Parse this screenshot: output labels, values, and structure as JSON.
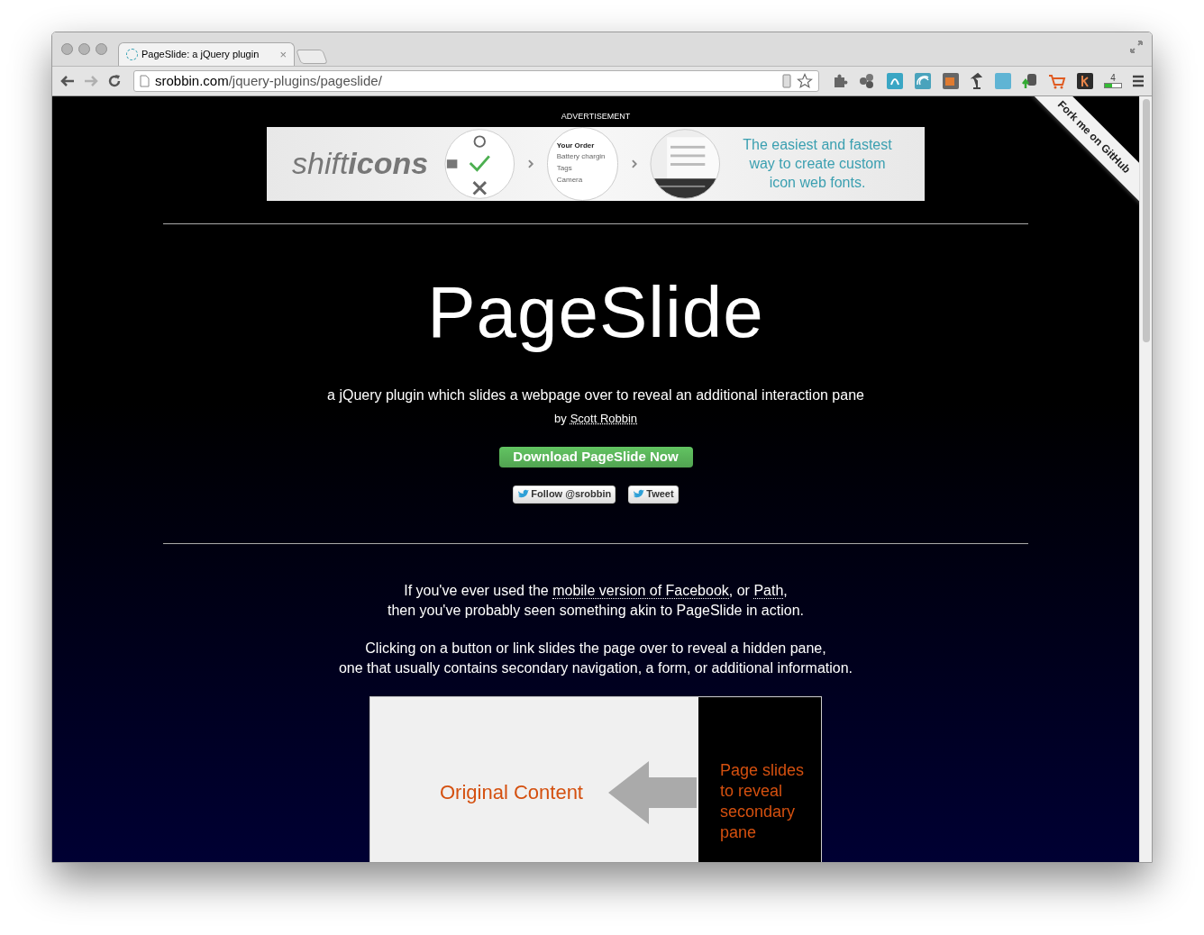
{
  "browser": {
    "tab": {
      "title": "PageSlide: a jQuery plugin",
      "close": "×"
    },
    "address": {
      "domain": "srobbin.com",
      "path": "/jquery-plugins/pageslide/"
    },
    "forward_disabled": true,
    "extension_badge": "4"
  },
  "ad": {
    "label": "ADVERTISEMENT",
    "logo_light": "shift",
    "logo_bold": "icons",
    "order_title": "Your Order",
    "order_items": [
      "Battery chargin",
      "Tags",
      "Camera"
    ],
    "tagline": "The easiest and fastest way to create custom icon web fonts."
  },
  "ribbon": "Fork me on GitHub",
  "hero": {
    "title": "PageSlide",
    "subtitle": "a jQuery plugin which slides a webpage over to reveal an additional interaction pane",
    "byline_prefix": "by",
    "author_link": "Scott Robbin",
    "download_button": "Download PageSlide Now",
    "follow_button": "Follow @srobbin",
    "tweet_button": "Tweet"
  },
  "intro": [
    [
      [
        {
          "text": "If you've ever used the ",
          "link": false
        },
        {
          "text": "mobile version of Facebook",
          "link": true
        },
        {
          "text": ", or ",
          "link": false
        },
        {
          "text": "Path",
          "link": true
        },
        {
          "text": ",",
          "link": false
        }
      ],
      [
        {
          "text": "then you've probably seen something akin to PageSlide in action.",
          "link": false
        }
      ]
    ],
    [
      [
        {
          "text": "Clicking on a button or link slides the page over to reveal a hidden pane,",
          "link": false
        }
      ],
      [
        {
          "text": "one that usually contains secondary navigation, a form, or additional information.",
          "link": false
        }
      ]
    ]
  ],
  "diagram": {
    "original": "Original Content",
    "pane": "Page slides to reveal secondary pane"
  }
}
